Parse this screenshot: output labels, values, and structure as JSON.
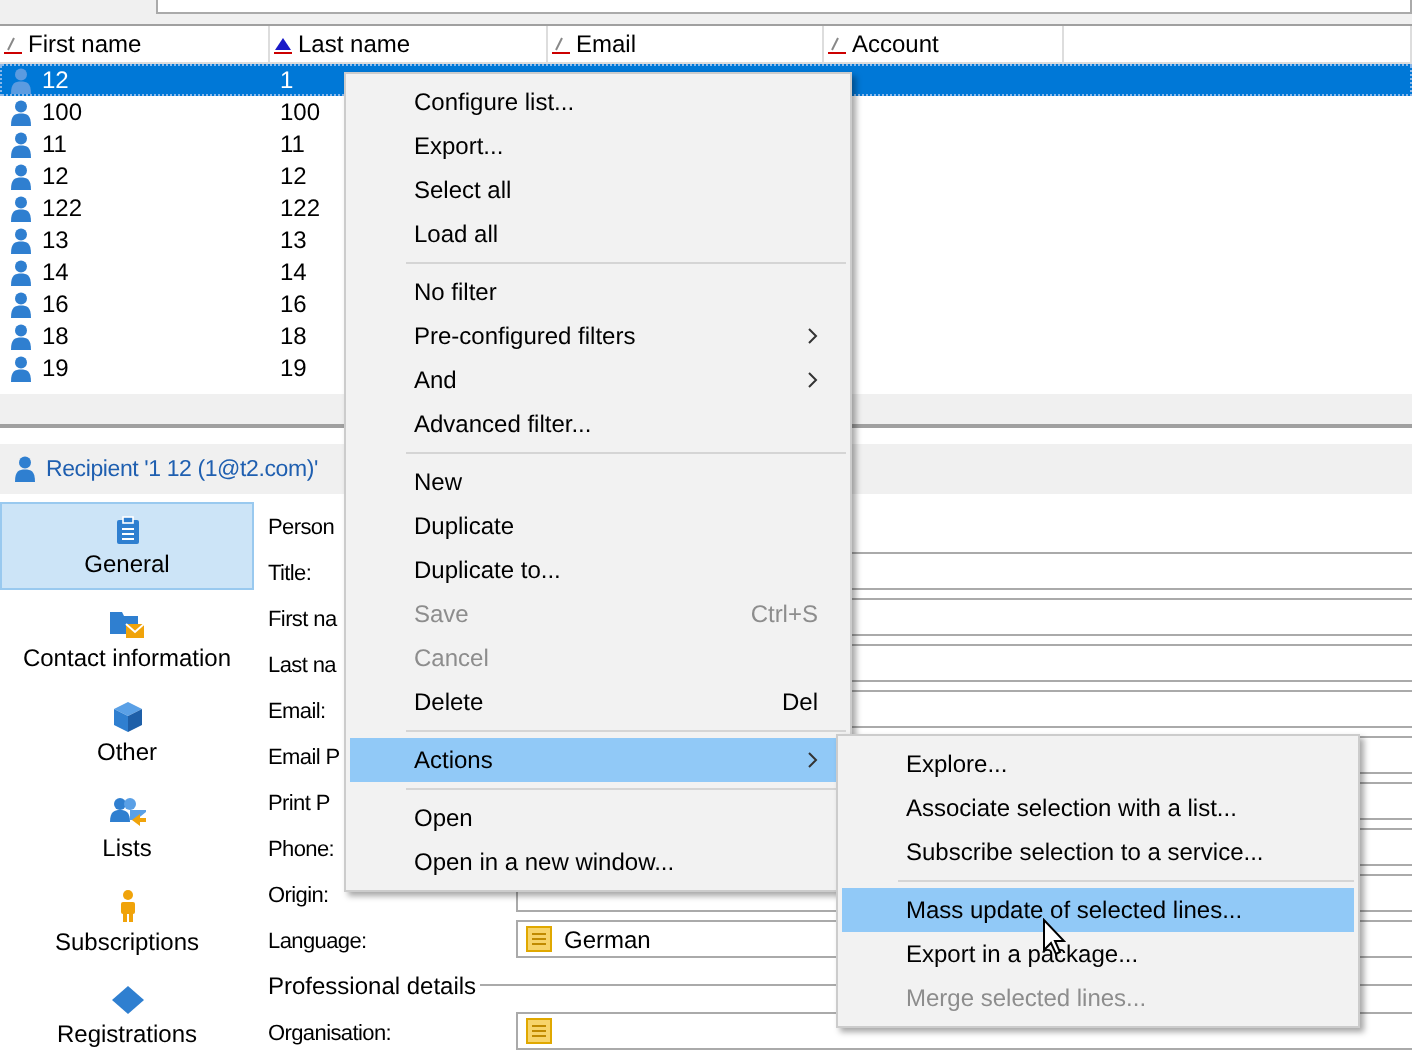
{
  "list": {
    "columns": [
      {
        "label": "First name",
        "sorted": false
      },
      {
        "label": "Last name",
        "sorted": true
      },
      {
        "label": "Email",
        "sorted": false
      },
      {
        "label": "Account",
        "sorted": false
      }
    ],
    "rows": [
      {
        "cells": [
          "12",
          "1"
        ],
        "selected": true
      },
      {
        "cells": [
          "100",
          "100"
        ],
        "selected": false
      },
      {
        "cells": [
          "11",
          "11"
        ],
        "selected": false
      },
      {
        "cells": [
          "12",
          "12"
        ],
        "selected": false
      },
      {
        "cells": [
          "122",
          "122"
        ],
        "selected": false
      },
      {
        "cells": [
          "13",
          "13"
        ],
        "selected": false
      },
      {
        "cells": [
          "14",
          "14"
        ],
        "selected": false
      },
      {
        "cells": [
          "16",
          "16"
        ],
        "selected": false
      },
      {
        "cells": [
          "18",
          "18"
        ],
        "selected": false
      },
      {
        "cells": [
          "19",
          "19"
        ],
        "selected": false
      }
    ]
  },
  "detail": {
    "title": "Recipient '1 12 (1@t2.com)'",
    "nav": [
      {
        "label": "General",
        "selected": true
      },
      {
        "label": "Contact information",
        "selected": false
      },
      {
        "label": "Other",
        "selected": false
      },
      {
        "label": "Lists",
        "selected": false
      },
      {
        "label": "Subscriptions",
        "selected": false
      },
      {
        "label": "Registrations",
        "selected": false
      }
    ],
    "fields": [
      {
        "kind": "label",
        "label": "Person"
      },
      {
        "kind": "field",
        "label": "Title:"
      },
      {
        "kind": "field",
        "label": "First na"
      },
      {
        "kind": "field",
        "label": "Last na"
      },
      {
        "kind": "field",
        "label": "Email:"
      },
      {
        "kind": "field",
        "label": "Email P"
      },
      {
        "kind": "field",
        "label": "Print P"
      },
      {
        "kind": "field",
        "label": "Phone:"
      },
      {
        "kind": "field",
        "label": "Origin:"
      },
      {
        "kind": "combo",
        "label": "Language:",
        "value": "German"
      },
      {
        "kind": "section",
        "label": "Professional details"
      },
      {
        "kind": "combo",
        "label": "Organisation:"
      }
    ]
  },
  "context_menu": {
    "items": [
      {
        "kind": "item",
        "label": "Configure list...",
        "disabled": false,
        "submenu": false,
        "selected": false
      },
      {
        "kind": "item",
        "label": "Export...",
        "disabled": false,
        "submenu": false,
        "selected": false
      },
      {
        "kind": "item",
        "label": "Select all",
        "disabled": false,
        "submenu": false,
        "selected": false
      },
      {
        "kind": "item",
        "label": "Load all",
        "disabled": false,
        "submenu": false,
        "selected": false
      },
      {
        "kind": "separator"
      },
      {
        "kind": "item",
        "label": "No filter",
        "disabled": false,
        "submenu": false,
        "selected": false
      },
      {
        "kind": "item",
        "label": "Pre-configured filters",
        "disabled": false,
        "submenu": true,
        "selected": false
      },
      {
        "kind": "item",
        "label": "And",
        "disabled": false,
        "submenu": true,
        "selected": false
      },
      {
        "kind": "item",
        "label": "Advanced filter...",
        "disabled": false,
        "submenu": false,
        "selected": false
      },
      {
        "kind": "separator"
      },
      {
        "kind": "item",
        "label": "New",
        "disabled": false,
        "submenu": false,
        "selected": false
      },
      {
        "kind": "item",
        "label": "Duplicate",
        "disabled": false,
        "submenu": false,
        "selected": false
      },
      {
        "kind": "item",
        "label": "Duplicate to...",
        "disabled": false,
        "submenu": false,
        "selected": false
      },
      {
        "kind": "item",
        "label": "Save",
        "shortcut": "Ctrl+S",
        "disabled": true,
        "submenu": false,
        "selected": false
      },
      {
        "kind": "item",
        "label": "Cancel",
        "disabled": true,
        "submenu": false,
        "selected": false
      },
      {
        "kind": "item",
        "label": "Delete",
        "shortcut": "Del",
        "disabled": false,
        "submenu": false,
        "selected": false
      },
      {
        "kind": "separator"
      },
      {
        "kind": "item",
        "label": "Actions",
        "disabled": false,
        "submenu": true,
        "selected": true
      },
      {
        "kind": "separator"
      },
      {
        "kind": "item",
        "label": "Open",
        "disabled": false,
        "submenu": false,
        "selected": false
      },
      {
        "kind": "item",
        "label": "Open in a new window...",
        "disabled": false,
        "submenu": false,
        "selected": false
      }
    ]
  },
  "submenu": {
    "items": [
      {
        "kind": "item",
        "label": "Explore...",
        "disabled": false,
        "submenu": false,
        "selected": false
      },
      {
        "kind": "item",
        "label": "Associate selection with a list...",
        "disabled": false,
        "submenu": false,
        "selected": false
      },
      {
        "kind": "item",
        "label": "Subscribe selection to a service...",
        "disabled": false,
        "submenu": false,
        "selected": false
      },
      {
        "kind": "separator"
      },
      {
        "kind": "item",
        "label": "Mass update of selected lines...",
        "disabled": false,
        "submenu": false,
        "selected": true
      },
      {
        "kind": "item",
        "label": "Export in a package...",
        "disabled": false,
        "submenu": false,
        "selected": false
      },
      {
        "kind": "item",
        "label": "Merge selected lines...",
        "disabled": true,
        "submenu": false,
        "selected": false
      }
    ]
  }
}
